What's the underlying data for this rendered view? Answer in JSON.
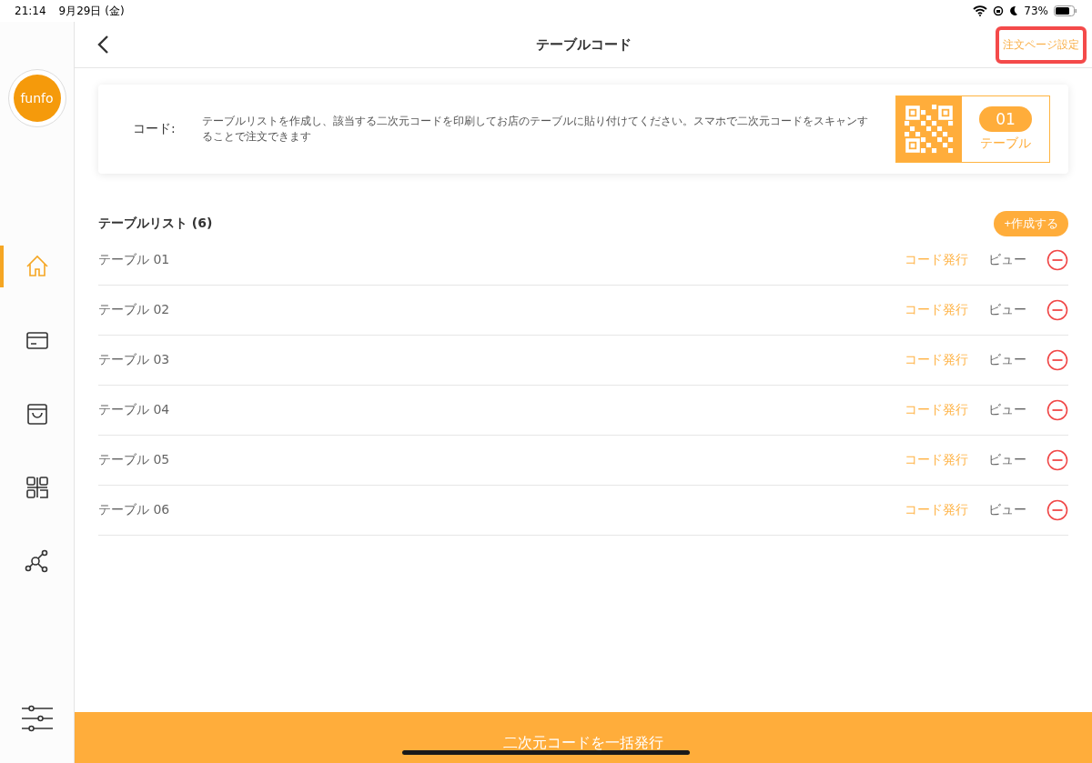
{
  "status_bar": {
    "time": "21:14",
    "date": "9月29日 (金)",
    "battery": "73%"
  },
  "sidebar": {
    "logo": "funfo",
    "items": [
      {
        "kind": "home",
        "selected": true
      },
      {
        "kind": "card",
        "selected": false
      },
      {
        "kind": "bag",
        "selected": false
      },
      {
        "kind": "qr",
        "selected": false
      },
      {
        "kind": "network",
        "selected": false
      }
    ]
  },
  "header": {
    "title": "テーブルコード",
    "action": "注文ページ設定"
  },
  "info_card": {
    "label": "コード:",
    "description": "テーブルリストを作成し、該当する二次元コードを印刷してお店のテーブルに貼り付けてください。スマホで二次元コードをスキャンすることで注文できます",
    "badge_number": "01",
    "badge_label": "テーブル"
  },
  "table_list": {
    "title": "テーブルリスト (6)",
    "create_button": "+作成する",
    "rows": [
      {
        "name": "テーブル 01",
        "issue": "コード発行",
        "view": "ビュー"
      },
      {
        "name": "テーブル 02",
        "issue": "コード発行",
        "view": "ビュー"
      },
      {
        "name": "テーブル 03",
        "issue": "コード発行",
        "view": "ビュー"
      },
      {
        "name": "テーブル 04",
        "issue": "コード発行",
        "view": "ビュー"
      },
      {
        "name": "テーブル 05",
        "issue": "コード発行",
        "view": "ビュー"
      },
      {
        "name": "テーブル 06",
        "issue": "コード発行",
        "view": "ビュー"
      }
    ]
  },
  "bottom_button": "二次元コードを一括発行"
}
